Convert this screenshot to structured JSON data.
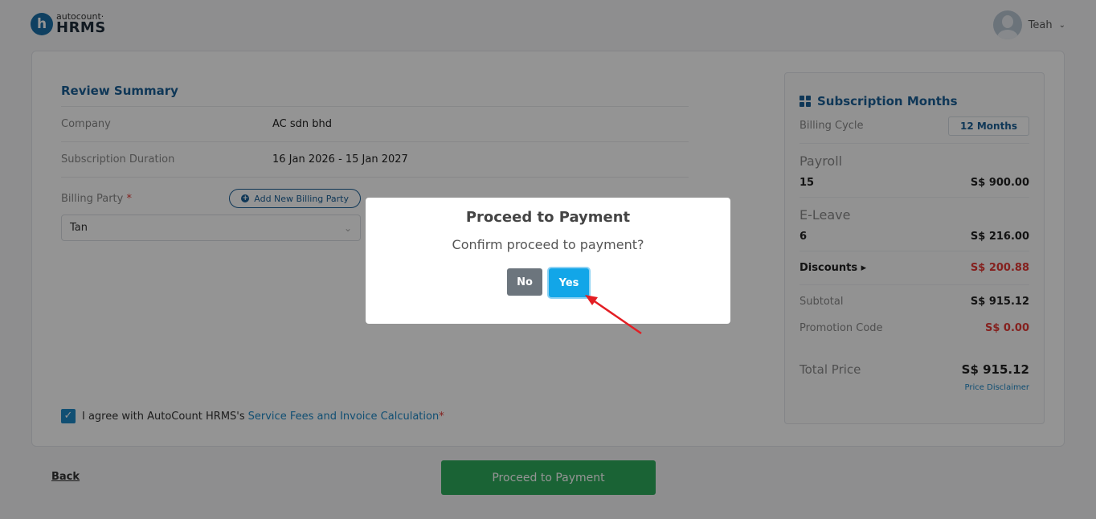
{
  "header": {
    "logo_mark": "h",
    "logo_sub": "autocount·",
    "logo_main": "HRMS",
    "user_name": "Teah",
    "user_chevron": "⌄"
  },
  "review": {
    "title": "Review Summary",
    "rows": [
      {
        "label": "Company",
        "value": "AC sdn bhd"
      },
      {
        "label": "Subscription Duration",
        "value": "16 Jan 2026 - 15 Jan 2027"
      }
    ],
    "billing_label": "Billing Party",
    "required_mark": "*",
    "add_billing_label": "Add New Billing Party",
    "billing_selected": "Tan",
    "agree_text": "I agree with AutoCount HRMS's",
    "agree_link": "Service Fees and Invoice Calculation"
  },
  "summary": {
    "title": "Subscription Months",
    "billing_cycle_label": "Billing Cycle",
    "billing_cycle_value": "12 Months",
    "items": [
      {
        "name": "Payroll",
        "qty": "15",
        "price": "S$ 900.00"
      },
      {
        "name": "E-Leave",
        "qty": "6",
        "price": "S$ 216.00"
      }
    ],
    "discounts_label": "Discounts ▸",
    "discounts_value": "S$ 200.88",
    "subtotal_label": "Subtotal",
    "subtotal_value": "S$ 915.12",
    "promo_label": "Promotion Code",
    "promo_value": "S$ 0.00",
    "total_label": "Total Price",
    "total_value": "S$ 915.12",
    "disclaimer": "Price Disclaimer"
  },
  "footer": {
    "back_label": "Back",
    "proceed_label": "Proceed to Payment"
  },
  "modal": {
    "title": "Proceed to Payment",
    "message": "Confirm proceed to payment?",
    "no_label": "No",
    "yes_label": "Yes"
  },
  "colors": {
    "accent": "#1b5f96",
    "link": "#1e88c7",
    "proceed": "#2eab5c",
    "yes": "#12a6e8",
    "danger": "#e53935"
  }
}
